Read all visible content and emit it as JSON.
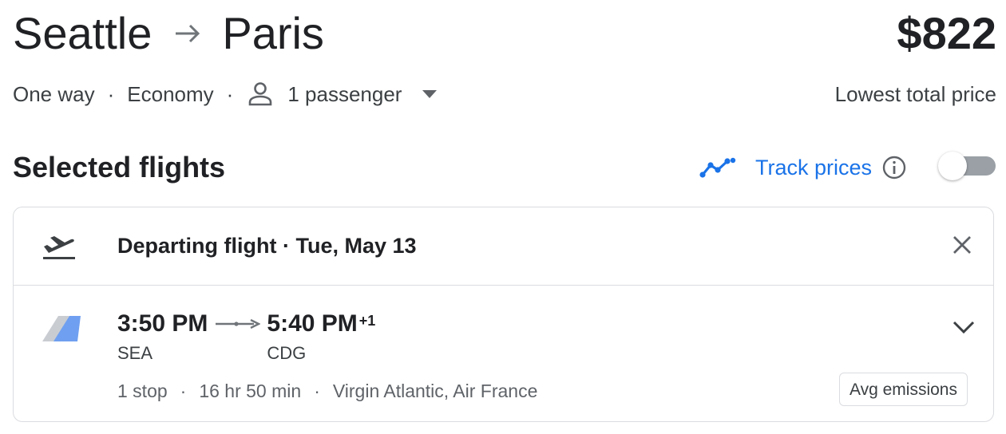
{
  "header": {
    "origin": "Seattle",
    "destination": "Paris",
    "price": "$822",
    "price_caption": "Lowest total price"
  },
  "trip_options": {
    "trip_type": "One way",
    "cabin": "Economy",
    "passengers": "1 passenger",
    "separator": "·"
  },
  "selected": {
    "title": "Selected flights",
    "track_label": "Track prices",
    "track_enabled": false
  },
  "flight": {
    "section_label": "Departing flight · Tue, May 13",
    "depart_time": "3:50 PM",
    "arrive_time": "5:40 PM",
    "day_offset": "+1",
    "origin_code": "SEA",
    "dest_code": "CDG",
    "stops": "1 stop",
    "duration": "16 hr 50 min",
    "airlines": "Virgin Atlantic, Air France",
    "emissions": "Avg emissions"
  },
  "icons": {
    "route_arrow": "arrow-right-icon",
    "passenger": "person-icon",
    "dropdown": "caret-down-icon",
    "track": "trend-line-icon",
    "info": "info-icon",
    "departure": "flight-takeoff-icon",
    "close": "close-icon",
    "airline_logo": "airline-logo",
    "expand": "chevron-down-icon"
  },
  "colors": {
    "accent": "#1a73e8",
    "text": "#202124",
    "secondary_text": "#5f6368",
    "border": "#dadce0"
  }
}
